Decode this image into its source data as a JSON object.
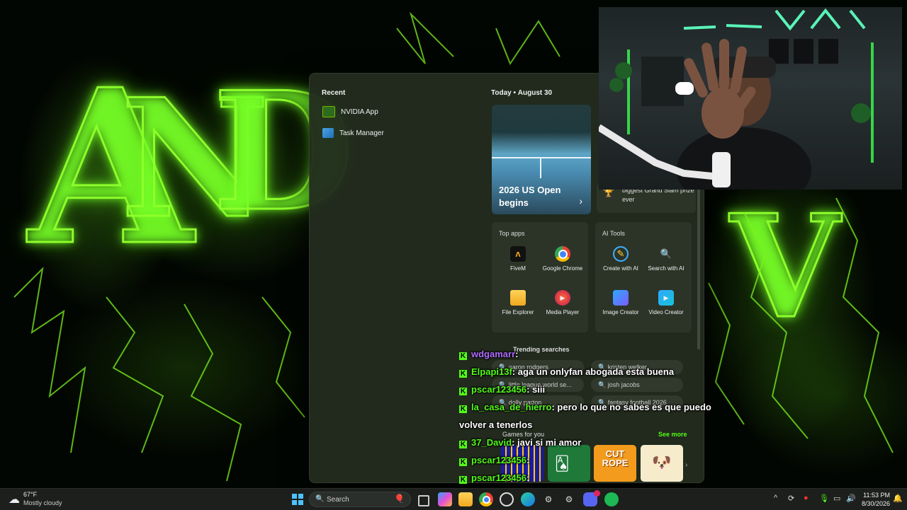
{
  "start_menu": {
    "recent_title": "Recent",
    "recent_items": [
      {
        "label": "NVIDIA App",
        "icon": "nvidia-icon"
      },
      {
        "label": "Task Manager",
        "icon": "task-manager-icon"
      }
    ],
    "today": "Today",
    "date": "August 30",
    "news_headline": "2026 US Open begins",
    "news_second": "biggest Grand Slam prize ever",
    "top_apps_title": "Top apps",
    "top_apps": [
      {
        "label": "FiveM",
        "icon": "fivem-icon"
      },
      {
        "label": "Google Chrome",
        "icon": "chrome-icon"
      },
      {
        "label": "File Explorer",
        "icon": "folder-icon"
      },
      {
        "label": "Media Player",
        "icon": "media-player-icon"
      }
    ],
    "ai_tools_title": "AI Tools",
    "ai_tools": [
      {
        "label": "Create with AI",
        "icon": "create-ai-icon"
      },
      {
        "label": "Search with AI",
        "icon": "search-ai-icon"
      },
      {
        "label": "Image Creator",
        "icon": "image-creator-icon"
      },
      {
        "label": "Video Creator",
        "icon": "video-creator-icon"
      }
    ],
    "trending_title": "Trending searches",
    "trending": [
      "aaron rodgers",
      "kristen welker",
      "little league world se...",
      "josh jacobs",
      "dolly parton",
      "fantasy football 2026"
    ],
    "games_title": "Games for you",
    "see_more": "See more",
    "games": [
      "Pac-Man",
      "Solitaire",
      "Cut the Rope",
      "Shiba"
    ],
    "cut_rope_text": "CUT ROPE"
  },
  "chat": [
    {
      "user": "wdgamarr",
      "text": ":",
      "color": "#b06cff"
    },
    {
      "user": "Elpapi13f",
      "text": ": aga un onlyfan abogada esta buena",
      "color": "#53fc18"
    },
    {
      "user": "pscar123456",
      "text": ": siii",
      "color": "#53fc18"
    },
    {
      "user": "la_casa_de_hierro",
      "text": ": pero lo que no sabes es que puedo volver a tenerlos",
      "color": "#53fc18"
    },
    {
      "user": "37_David",
      "text": ": javi si mi amor",
      "color": "#53fc18"
    },
    {
      "user": "pscar123456",
      "text": ":",
      "color": "#53fc18"
    },
    {
      "user": "pscar123456",
      "text": ":",
      "color": "#53fc18"
    },
    {
      "user": "pscar123456",
      "text": ":",
      "color": "#53fc18"
    }
  ],
  "taskbar": {
    "weather_temp": "67°F",
    "weather_desc": "Mostly cloudy",
    "search_placeholder": "Search",
    "time": "11:53 PM",
    "date": "8/30/2026"
  },
  "colors": {
    "accent_green": "#53fc18",
    "wallpaper_glow": "#8dff2a"
  }
}
